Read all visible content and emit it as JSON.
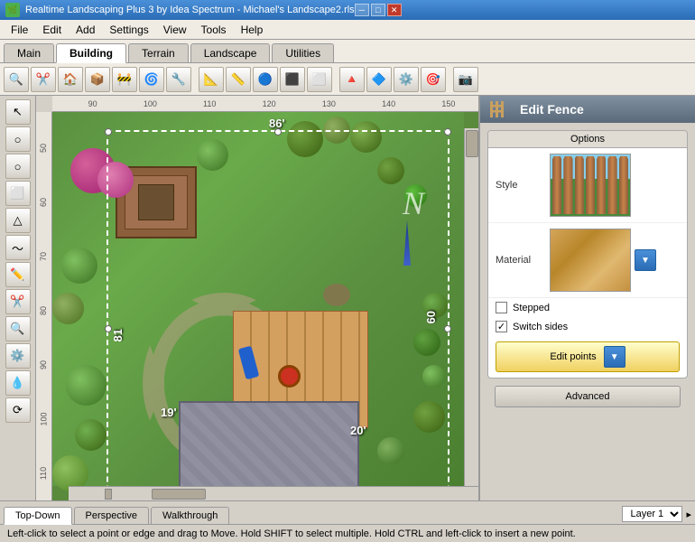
{
  "titlebar": {
    "title": "Realtime Landscaping Plus 3 by Idea Spectrum - Michael's Landscape2.rls",
    "icon": "🌿"
  },
  "titlebar_controls": {
    "minimize": "─",
    "maximize": "□",
    "close": "✕"
  },
  "menubar": {
    "items": [
      "File",
      "Edit",
      "Add",
      "Settings",
      "View",
      "Tools",
      "Help"
    ]
  },
  "tabs": {
    "items": [
      "Main",
      "Building",
      "Terrain",
      "Landscape",
      "Utilities"
    ],
    "active": "Building"
  },
  "toolbar_icons": [
    "🔍",
    "✂️",
    "🏠",
    "📦",
    "🌿",
    "🌀",
    "🔧",
    "🚧",
    "📐",
    "📏",
    "🔵",
    "⬛",
    "⬜",
    "🔺",
    "🔷",
    "⚙️",
    "🎯",
    "📷"
  ],
  "left_tools": [
    "↖",
    "○",
    "○",
    "⬜",
    "△",
    "〜",
    "✏️",
    "✂️",
    "🔍",
    "⚙️",
    "💧",
    "⟳"
  ],
  "canvas": {
    "ruler_marks_h": [
      "90",
      "100",
      "110",
      "120",
      "130",
      "140",
      "150"
    ],
    "ruler_marks_v": [
      "50",
      "60",
      "70",
      "80",
      "90",
      "100",
      "110"
    ],
    "dimensions": {
      "top": "86'",
      "right": "60",
      "bottom": "20'",
      "left": "81",
      "bottom_left": "19'"
    },
    "north_label": "N"
  },
  "right_panel": {
    "title": "Edit Fence",
    "options_label": "Options",
    "style_label": "Style",
    "material_label": "Material",
    "stepped_label": "Stepped",
    "switch_sides_label": "Switch sides",
    "switch_sides_checked": true,
    "stepped_checked": false,
    "edit_points_label": "Edit points",
    "advanced_label": "Advanced",
    "dropdown_arrow": "▼"
  },
  "view_tabs": {
    "items": [
      "Top-Down",
      "Perspective",
      "Walkthrough"
    ],
    "active": "Top-Down"
  },
  "layer": {
    "label": "Layer 1",
    "arrow": "▸"
  },
  "statusbar": {
    "text": "Left-click to select a point or edge and drag to Move. Hold SHIFT to select multiple. Hold CTRL and left-click to insert a new point."
  }
}
